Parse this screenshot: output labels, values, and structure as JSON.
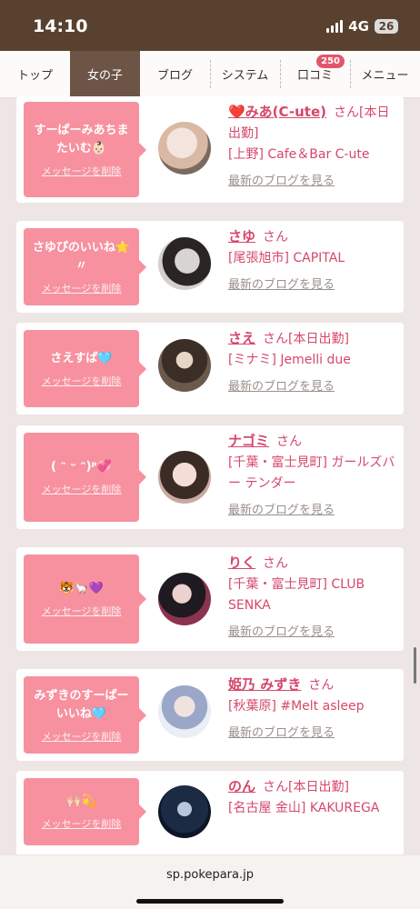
{
  "status": {
    "time": "14:10",
    "network": "4G",
    "battery": "26"
  },
  "nav": {
    "tabs": [
      {
        "label": "トップ"
      },
      {
        "label": "女の子"
      },
      {
        "label": "ブログ"
      },
      {
        "label": "システム"
      },
      {
        "label": "口コミ",
        "badge": "250"
      },
      {
        "label": "メニュー"
      }
    ],
    "active_index": 1
  },
  "cards": [
    {
      "message": "すーぱーみあちまたいむ👶🏻",
      "delete": "メッセージを削除",
      "name": "❤️みあ(C-ute)",
      "san": "さん",
      "note": "[本日出勤]",
      "shop": "[上野] Cafe＆Bar C-ute",
      "blog": "最新のブログを見る"
    },
    {
      "message": "さゆぴのいいね⭐️〃",
      "delete": "メッセージを削除",
      "name": "さゆ",
      "san": "さん",
      "note": "",
      "shop": "[尾張旭市] CAPITAL",
      "blog": "最新のブログを見る"
    },
    {
      "message": "さえすぱ🩵",
      "delete": "メッセージを削除",
      "name": "さえ",
      "san": "さん",
      "note": "[本日出勤]",
      "shop": "[ミナミ] Jemelli due",
      "blog": "最新のブログを見る"
    },
    {
      "message": "( ᵔ ᵕ ᵔ)ᵖ💞",
      "delete": "メッセージを削除",
      "name": "ナゴミ",
      "san": "さん",
      "note": "",
      "shop": "[千葉・富士見町] ガールズバー テンダー",
      "blog": "最新のブログを見る"
    },
    {
      "message": "🐯🦙💜",
      "delete": "メッセージを削除",
      "name": "りく",
      "san": "さん",
      "note": "",
      "shop": "[千葉・富士見町] CLUB SENKA",
      "blog": "最新のブログを見る"
    },
    {
      "message": "みずきのすーぱーいいね🩵",
      "delete": "メッセージを削除",
      "name": "姫乃 みずき",
      "san": "さん",
      "note": "",
      "shop": "[秋葉原] #Melt asleep",
      "blog": "最新のブログを見る"
    },
    {
      "message": "🙌🏻💫",
      "delete": "メッセージを削除",
      "name": "のん",
      "san": "さん",
      "note": "[本日出勤]",
      "shop": "[名古屋 金山] KAKUREGA",
      "blog": ""
    }
  ],
  "url": "sp.pokepara.jp",
  "colors": {
    "bubble": "#f7919f",
    "link": "#d6476a",
    "header": "#58412f",
    "active_tab": "#6c5547"
  }
}
